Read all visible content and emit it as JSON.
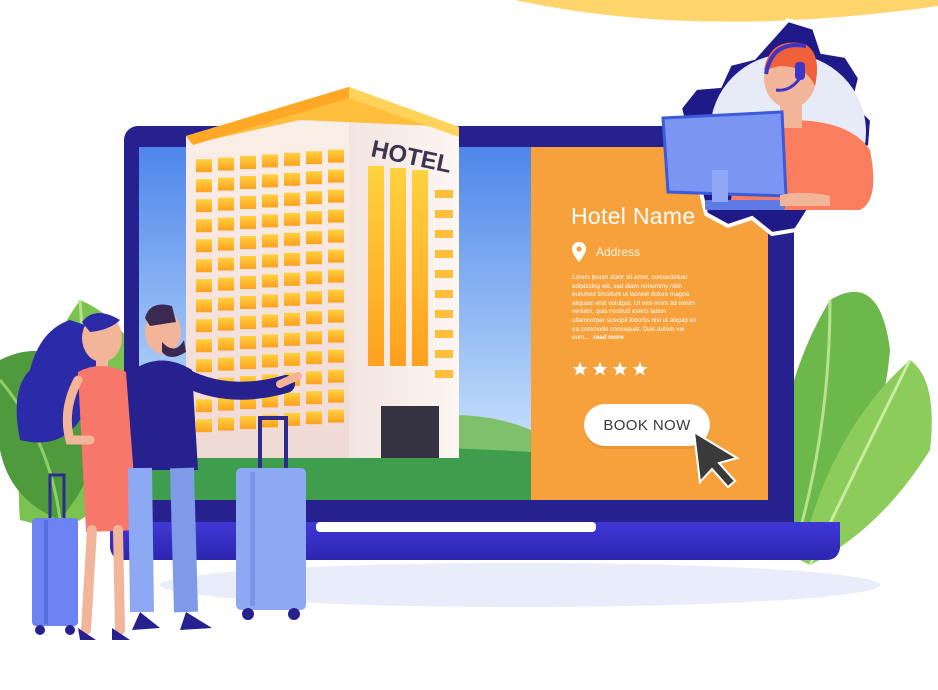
{
  "card": {
    "title": "Hotel Name",
    "address_label": "Address",
    "description": "Lorem ipsum dolor sit amet, consectetuer adipiscing elit, sed diam nonummy nibh euismod tincidunt ut laoreet dolore magna aliquam erat volutpat. Ut wisi enim ad minim veniam, quis nostrud exerci tation ullamcorper suscipit lobortis nisl ut aliquip ex ea commodo consequat. Duis autem vel eum...",
    "read_more": "read more",
    "rating": 4,
    "book_button": "BOOK NOW"
  },
  "building": {
    "sign": "HOTEL"
  },
  "icons": [
    "map-pin-icon",
    "star-icon",
    "mouse-pointer-icon",
    "headset-icon",
    "gear-icon"
  ],
  "colors": {
    "laptop_frame": "#27208f",
    "card_orange": "#f7a13c",
    "sky_top": "#5a8fe8",
    "grass": "#3f9e4d",
    "building_wall": "#f5e9e3",
    "windows": "#ffb627",
    "leaf_green": "#7bc250",
    "accent_yellow": "#ffd25a"
  }
}
